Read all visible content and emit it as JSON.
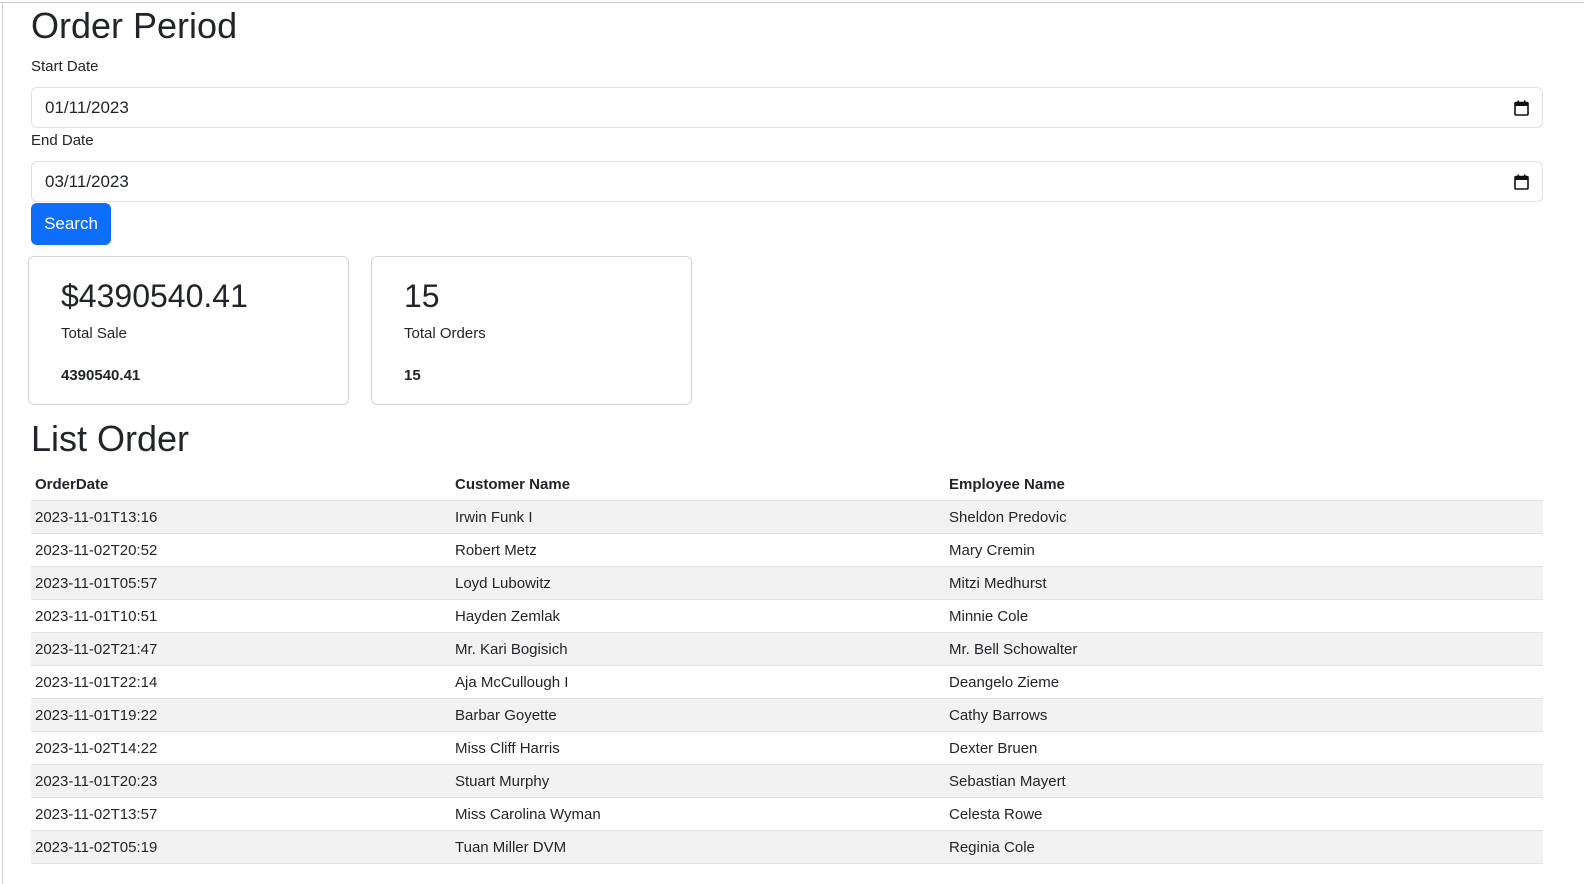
{
  "order_period": {
    "title": "Order Period",
    "start_label": "Start Date",
    "start_value": "01/11/2023",
    "end_label": "End Date",
    "end_value": "03/11/2023",
    "search_label": "Search"
  },
  "summary": {
    "sale": {
      "value": "$4390540.41",
      "label": "Total Sale",
      "detail": "4390540.41"
    },
    "orders": {
      "value": "15",
      "label": "Total Orders",
      "detail": "15"
    }
  },
  "list": {
    "title": "List Order",
    "columns": [
      "OrderDate",
      "Customer Name",
      "Employee Name"
    ],
    "rows": [
      [
        "2023-11-01T13:16",
        "Irwin Funk I",
        "Sheldon Predovic"
      ],
      [
        "2023-11-02T20:52",
        "Robert Metz",
        "Mary Cremin"
      ],
      [
        "2023-11-01T05:57",
        "Loyd Lubowitz",
        "Mitzi Medhurst"
      ],
      [
        "2023-11-01T10:51",
        "Hayden Zemlak",
        "Minnie Cole"
      ],
      [
        "2023-11-02T21:47",
        "Mr. Kari Bogisich",
        "Mr. Bell Schowalter"
      ],
      [
        "2023-11-01T22:14",
        "Aja McCullough I",
        "Deangelo Zieme"
      ],
      [
        "2023-11-01T19:22",
        "Barbar Goyette",
        "Cathy Barrows"
      ],
      [
        "2023-11-02T14:22",
        "Miss Cliff Harris",
        "Dexter Bruen"
      ],
      [
        "2023-11-01T20:23",
        "Stuart Murphy",
        "Sebastian Mayert"
      ],
      [
        "2023-11-02T13:57",
        "Miss Carolina Wyman",
        "Celesta Rowe"
      ],
      [
        "2023-11-02T05:19",
        "Tuan Miller DVM",
        "Reginia Cole"
      ]
    ]
  }
}
